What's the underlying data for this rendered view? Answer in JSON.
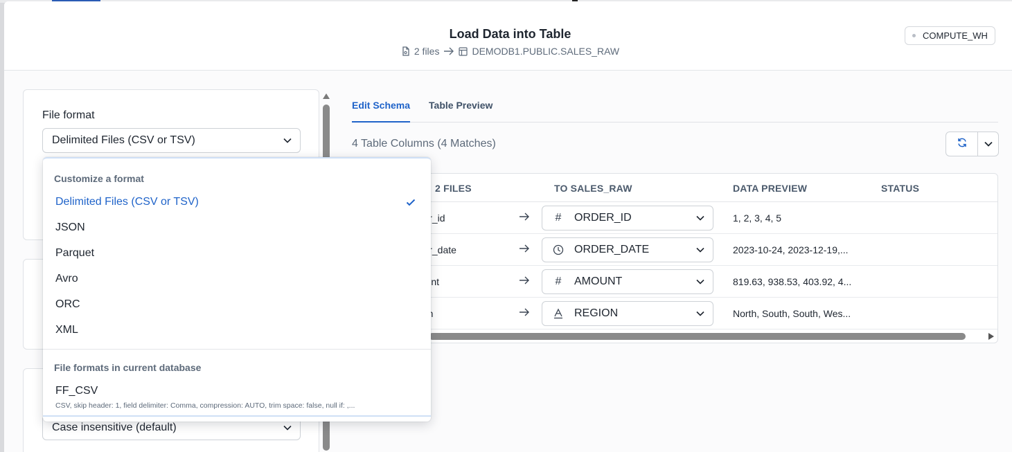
{
  "header": {
    "title": "Load Data into Table",
    "files": "2 files",
    "target_table": "DEMODB1.PUBLIC.SALES_RAW",
    "warehouse": "COMPUTE_WH"
  },
  "left": {
    "file_format_label": "File format",
    "file_format_value": "Delimited Files (CSV or TSV)",
    "case_value": "Case insensitive (default)"
  },
  "dropdown": {
    "group1_label": "Customize a format",
    "options": [
      "Delimited Files (CSV or TSV)",
      "JSON",
      "Parquet",
      "Avro",
      "ORC",
      "XML"
    ],
    "selected": "Delimited Files (CSV or TSV)",
    "group2_label": "File formats in current database",
    "ff_name": "FF_CSV",
    "ff_desc": "CSV, skip header: 1, field delimiter: Comma, compression: AUTO, trim space: false, null if: ,..."
  },
  "tabs": [
    "Edit Schema",
    "Table Preview"
  ],
  "active_tab": "Edit Schema",
  "columns_summary": "4 Table Columns (4 Matches)",
  "table": {
    "headers": {
      "source": "2 FILES",
      "target": "TO SALES_RAW",
      "preview": "DATA PREVIEW",
      "status": "STATUS"
    },
    "rows": [
      {
        "source": "rder_id",
        "type_icon": "hash-icon",
        "target": "ORDER_ID",
        "preview": "1, 2, 3, 4, 5"
      },
      {
        "source": "rder_date",
        "type_icon": "clock-icon",
        "target": "ORDER_DATE",
        "preview": "2023-10-24, 2023-12-19,..."
      },
      {
        "source": "nount",
        "type_icon": "hash-icon",
        "target": "AMOUNT",
        "preview": "819.63, 938.53, 403.92, 4..."
      },
      {
        "source": "gion",
        "type_icon": "text-type-icon",
        "target": "REGION",
        "preview": "North, South, South, Wes..."
      }
    ]
  },
  "colors": {
    "accent": "#1f63c9",
    "text": "#1e252f",
    "muted": "#5d6a7a"
  }
}
